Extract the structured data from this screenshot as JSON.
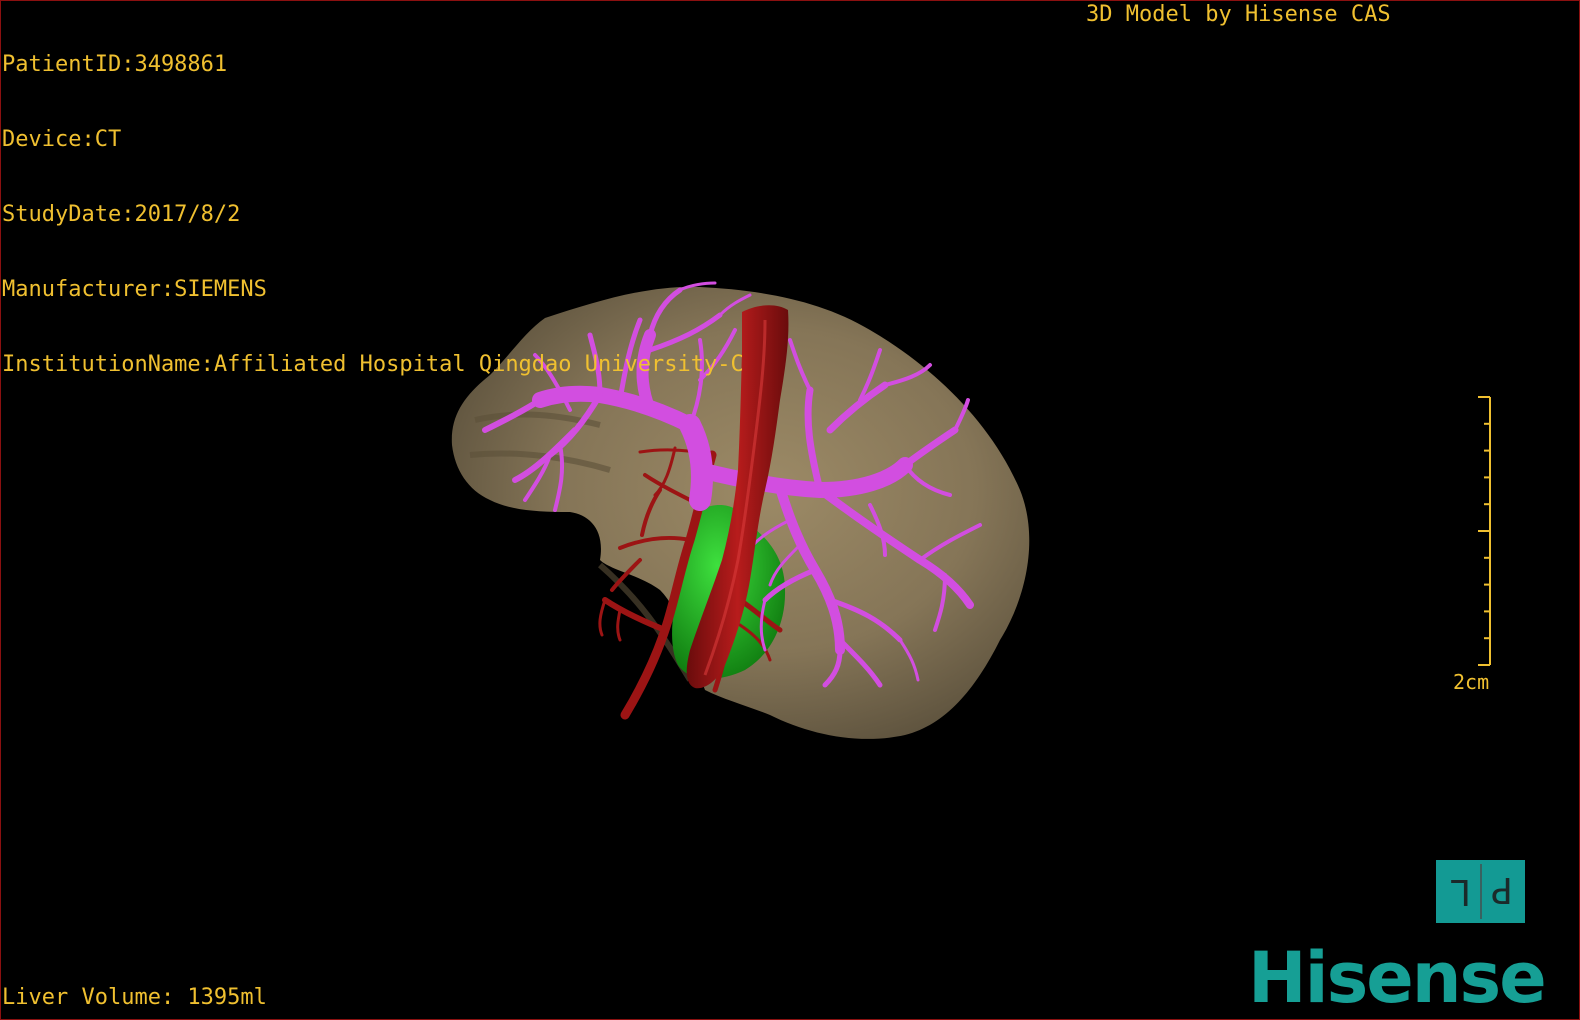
{
  "patient_info": {
    "patient_id": "PatientID:3498861",
    "device": "Device:CT",
    "study_date": "StudyDate:2017/8/2",
    "manufacturer": "Manufacturer:SIEMENS",
    "institution": "InstitutionName:Affiliated Hospital Qingdao University-C"
  },
  "credit": "3D Model by Hisense CAS",
  "liver_volume": "Liver Volume: 1395ml",
  "scale_bar": {
    "label": "2cm"
  },
  "orientation_cube": {
    "left_glyph": "L",
    "right_glyph": "P"
  },
  "brand_logo": "Hisense",
  "colors": {
    "overlay_text": "#f0c030",
    "liver": "#8a7a5c",
    "portal_vein": "#d24ee0",
    "artery_and_vena_cava": "#9c1414",
    "gallbladder": "#1fb81f",
    "brand": "#169f95",
    "frame": "#8b1010"
  }
}
